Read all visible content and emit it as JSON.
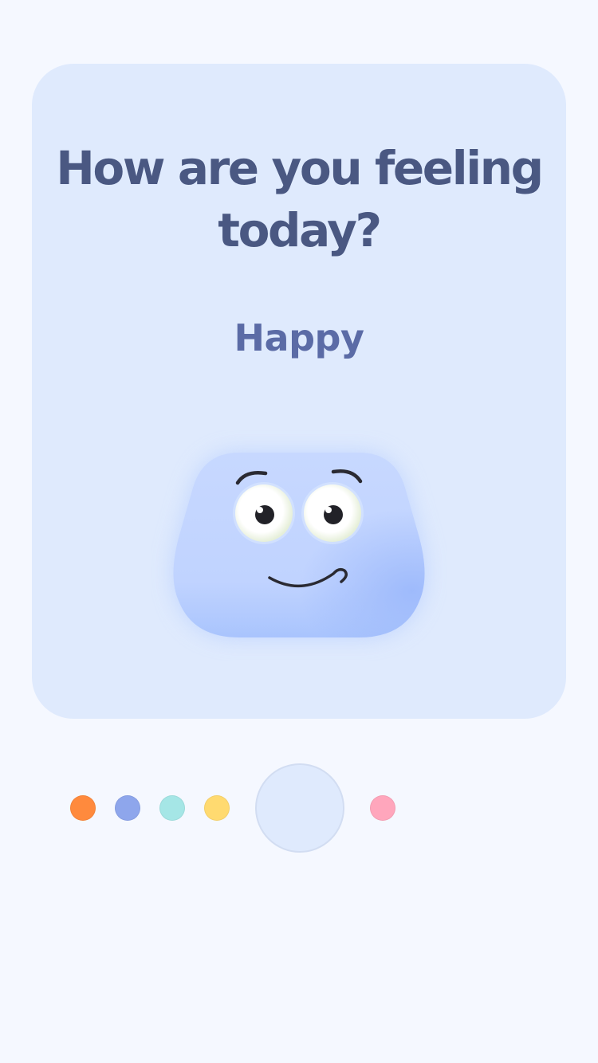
{
  "prompt": {
    "question": "How are you feeling today?"
  },
  "mood": {
    "selected_label": "Happy",
    "character": "happy-blob-face"
  },
  "colors": {
    "background": "#f5f8ff",
    "card": "#dfeafd",
    "question_text": "#4a5882",
    "mood_text": "#5b6ba6",
    "blob_light": "#c7d9ff",
    "blob_dark": "#a9c3fb"
  },
  "mood_picker": {
    "options": [
      {
        "color": "#ff8a3d"
      },
      {
        "color": "#8ea6ec"
      },
      {
        "color": "#a5e6e6"
      },
      {
        "color": "#ffda70"
      },
      {
        "color": "#dfeafd",
        "selected": true
      },
      {
        "color": "#ffa6bc"
      }
    ]
  }
}
